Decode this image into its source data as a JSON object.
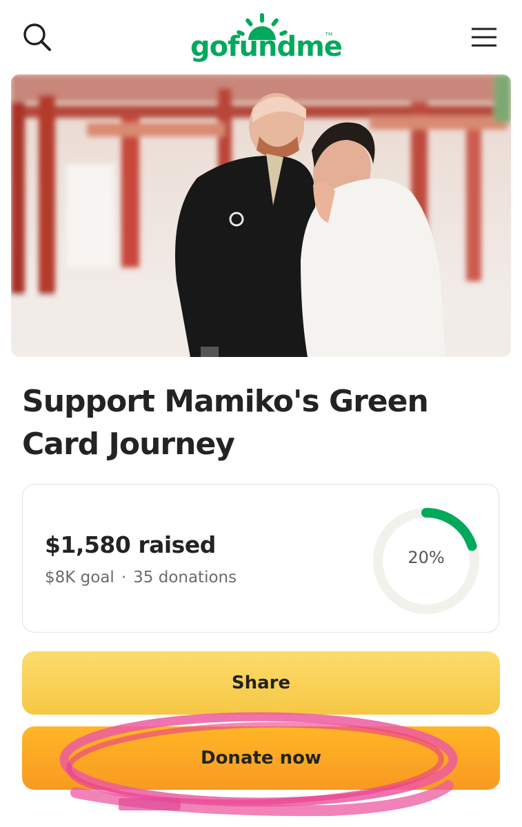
{
  "header": {
    "logo_text": "gofundme",
    "logo_tm": "TM",
    "search_icon": "search-icon",
    "menu_icon": "hamburger-menu-icon"
  },
  "campaign": {
    "title": "Support Mamiko's Green Card Journey"
  },
  "progress": {
    "raised": "$1,580 raised",
    "goal": "$8K goal",
    "separator": "·",
    "donations": "35 donations",
    "percent_label": "20%",
    "percent_value": 0.2
  },
  "buttons": {
    "share": "Share",
    "donate": "Donate now"
  },
  "colors": {
    "brand_green": "#02a95c",
    "share_yellow": "#f9d25a",
    "donate_orange": "#fba924",
    "annotation_pink": "#ec5aa0"
  }
}
